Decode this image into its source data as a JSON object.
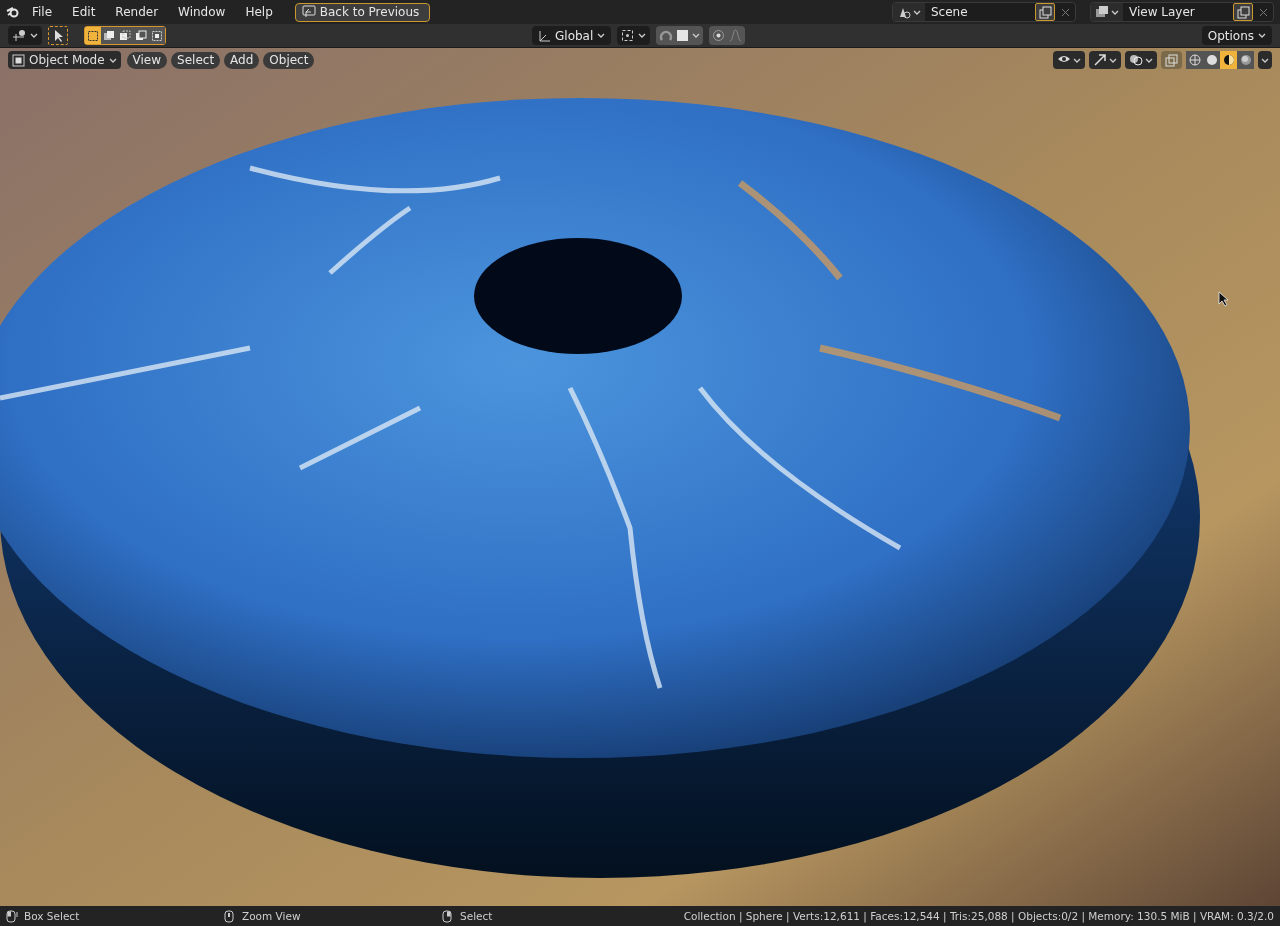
{
  "top_bar": {
    "menus": [
      "File",
      "Edit",
      "Render",
      "Window",
      "Help"
    ],
    "back_button": "Back to Previous",
    "scene": "Scene",
    "view_layer": "View Layer"
  },
  "tool_header": {
    "select_modes": [
      {
        "selected": true
      },
      {
        "selected": false
      },
      {
        "selected": false
      },
      {
        "selected": false
      },
      {
        "selected": false
      }
    ],
    "orientation": "Global",
    "options": "Options"
  },
  "viewport_header": {
    "mode": "Object Mode",
    "menus": [
      "View",
      "Select",
      "Add",
      "Object"
    ],
    "shading_modes": [
      {
        "selected": false
      },
      {
        "selected": false
      },
      {
        "selected": true
      },
      {
        "selected": false
      }
    ]
  },
  "status_bar": {
    "hints": [
      {
        "kind": "left",
        "label": "Box Select"
      },
      {
        "kind": "middle",
        "label": "Zoom View"
      },
      {
        "kind": "right",
        "label": "Select"
      }
    ],
    "stats": "Collection | Sphere | Verts:12,611 | Faces:12,544 | Tris:25,088 | Objects:0/2 | Memory: 130.5 MiB | VRAM: 0.3/2.0"
  }
}
